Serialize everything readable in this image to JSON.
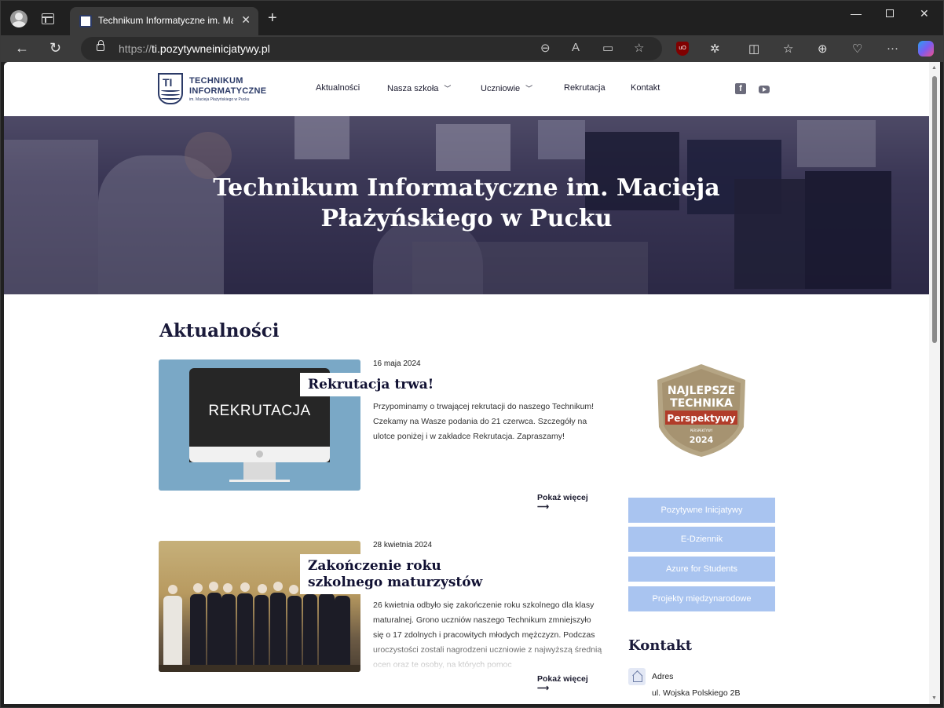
{
  "browser": {
    "tab_title": "Technikum Informatyczne im. Ma",
    "url_prefix": "https://",
    "url_host": "ti.pozytywneinicjatywy.pl",
    "icons": [
      "profile-icon",
      "tab-actions-icon",
      "close-icon",
      "new-tab-icon",
      "minimize-icon",
      "maximize-icon",
      "window-close-icon",
      "back-icon",
      "refresh-icon",
      "lock-icon",
      "zoom-out-icon",
      "read-aloud-icon",
      "immersive-reader-icon",
      "favorite-star-icon",
      "ublock-icon",
      "extensions-icon",
      "split-screen-icon",
      "favorites-icon",
      "collections-icon",
      "browser-essentials-icon",
      "more-icon",
      "copilot-icon"
    ]
  },
  "site": {
    "logo_line1": "TECHNIKUM",
    "logo_line2": "INFORMATYCZNE",
    "logo_sub": "im. Macieja Płażyńskiego w Pucku",
    "logo_mark": "TI",
    "nav": [
      {
        "label": "Aktualności"
      },
      {
        "label": "Nasza szkoła"
      },
      {
        "label": "Uczniowie"
      },
      {
        "label": "Rekrutacja"
      },
      {
        "label": "Kontakt"
      }
    ],
    "social_fb": "f"
  },
  "hero": {
    "title": "Technikum Informatyczne im. Macieja Płażyńskiego w Pucku"
  },
  "news_section": {
    "title": "Aktualności",
    "items": [
      {
        "date": "16 maja 2024",
        "title": "Rekrutacja trwa!",
        "image_text": "REKRUTACJA",
        "text": "Przypominamy o trwającej rekrutacji do naszego Technikum! Czekamy na Wasze podania do 21 czerwca. Szczegóły na ulotce poniżej i w zakładce Rekrutacja. Zapraszamy!",
        "more": "Pokaż więcej ⟶"
      },
      {
        "date": "28 kwietnia 2024",
        "title": "Zakończenie roku szkolnego maturzystów",
        "text": "26 kwietnia odbyło się zakończenie roku szkolnego dla klasy maturalnej. Grono uczniów naszego Technikum zmniejszyło się o 17 zdolnych i pracowitych młodych mężczyzn. Podczas uroczystości zostali nagrodzeni uczniowie z najwyższą średnią ocen oraz te osoby, na których pomoc",
        "more": "Pokaż więcej ⟶"
      }
    ]
  },
  "sidebar": {
    "badge": {
      "line1": "NAJLEPSZE",
      "line2": "TECHNIKA",
      "ribbon": "Perspektywy",
      "small": "PERSPEKTYWY",
      "year": "2024"
    },
    "buttons": [
      {
        "label": "Pozytywne Inicjatywy"
      },
      {
        "label": "E-Dziennik"
      },
      {
        "label": "Azure for Students"
      },
      {
        "label": "Projekty międzynarodowe"
      }
    ],
    "contact_title": "Kontakt",
    "address_label": "Adres",
    "address_value": "ul. Wojska Polskiego 2B"
  }
}
